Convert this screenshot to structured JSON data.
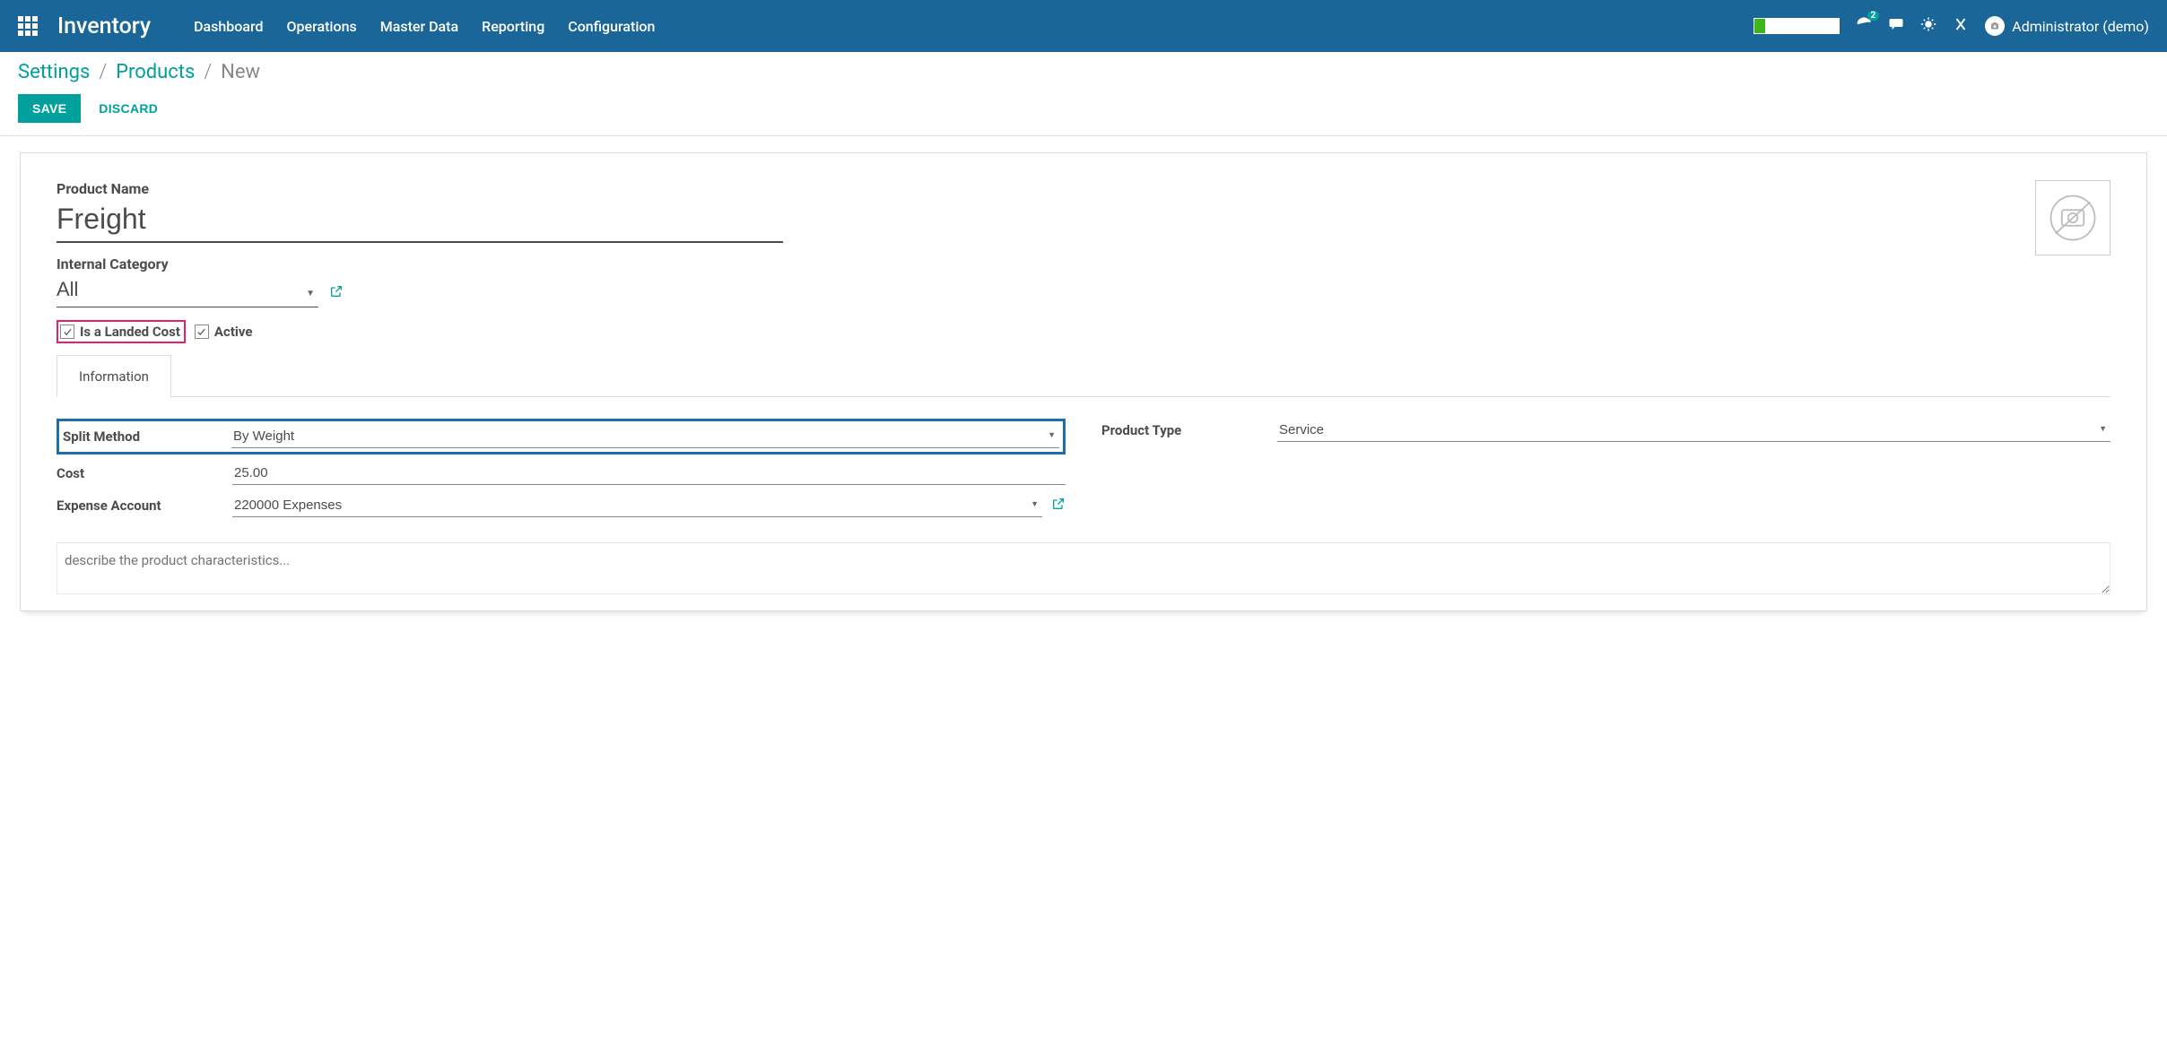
{
  "navbar": {
    "brand": "Inventory",
    "menu": [
      "Dashboard",
      "Operations",
      "Master Data",
      "Reporting",
      "Configuration"
    ],
    "badge_count": "2",
    "user_name": "Administrator (demo)"
  },
  "breadcrumb": {
    "items": [
      "Settings",
      "Products"
    ],
    "current": "New"
  },
  "actions": {
    "save": "SAVE",
    "discard": "DISCARD"
  },
  "form": {
    "product_name_label": "Product Name",
    "product_name_value": "Freight",
    "internal_category_label": "Internal Category",
    "internal_category_value": "All",
    "landed_cost_label": "Is a Landed Cost",
    "landed_cost_checked": true,
    "active_label": "Active",
    "active_checked": true
  },
  "tabs": {
    "information": "Information"
  },
  "fields": {
    "split_method_label": "Split Method",
    "split_method_value": "By Weight",
    "cost_label": "Cost",
    "cost_value": "25.00",
    "expense_account_label": "Expense Account",
    "expense_account_value": "220000 Expenses",
    "product_type_label": "Product Type",
    "product_type_value": "Service",
    "description_placeholder": "describe the product characteristics..."
  }
}
